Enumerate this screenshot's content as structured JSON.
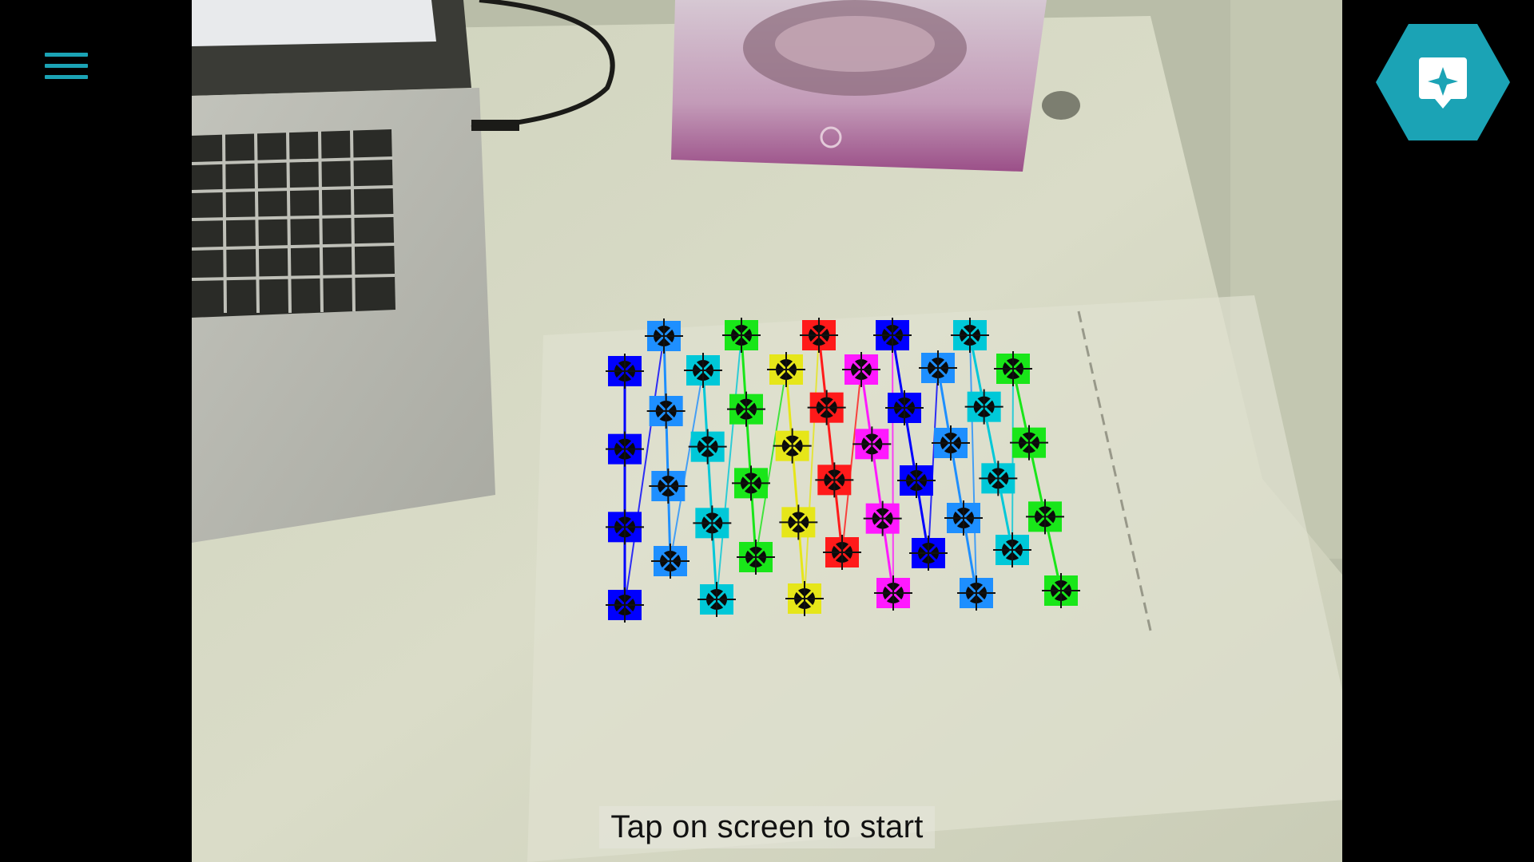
{
  "app": {
    "status_message": "Tap on screen to start"
  },
  "toolbar": {
    "menu_icon": "hamburger-menu-icon",
    "action_icon": "sparkle-bubble-icon"
  },
  "colors": {
    "accent": "#1ba3b5",
    "side_bars": "#000000",
    "table_surface": "#d9dcc9"
  },
  "ar_overlay": {
    "grid": "calibration-marker-grid",
    "column_colors": [
      "#0000ff",
      "#1e8fff",
      "#00c8d8",
      "#19e619",
      "#e6e619",
      "#ff1a1a",
      "#ff19ff",
      "#0000ff",
      "#1e8fff",
      "#00c8d8",
      "#19e619"
    ]
  }
}
